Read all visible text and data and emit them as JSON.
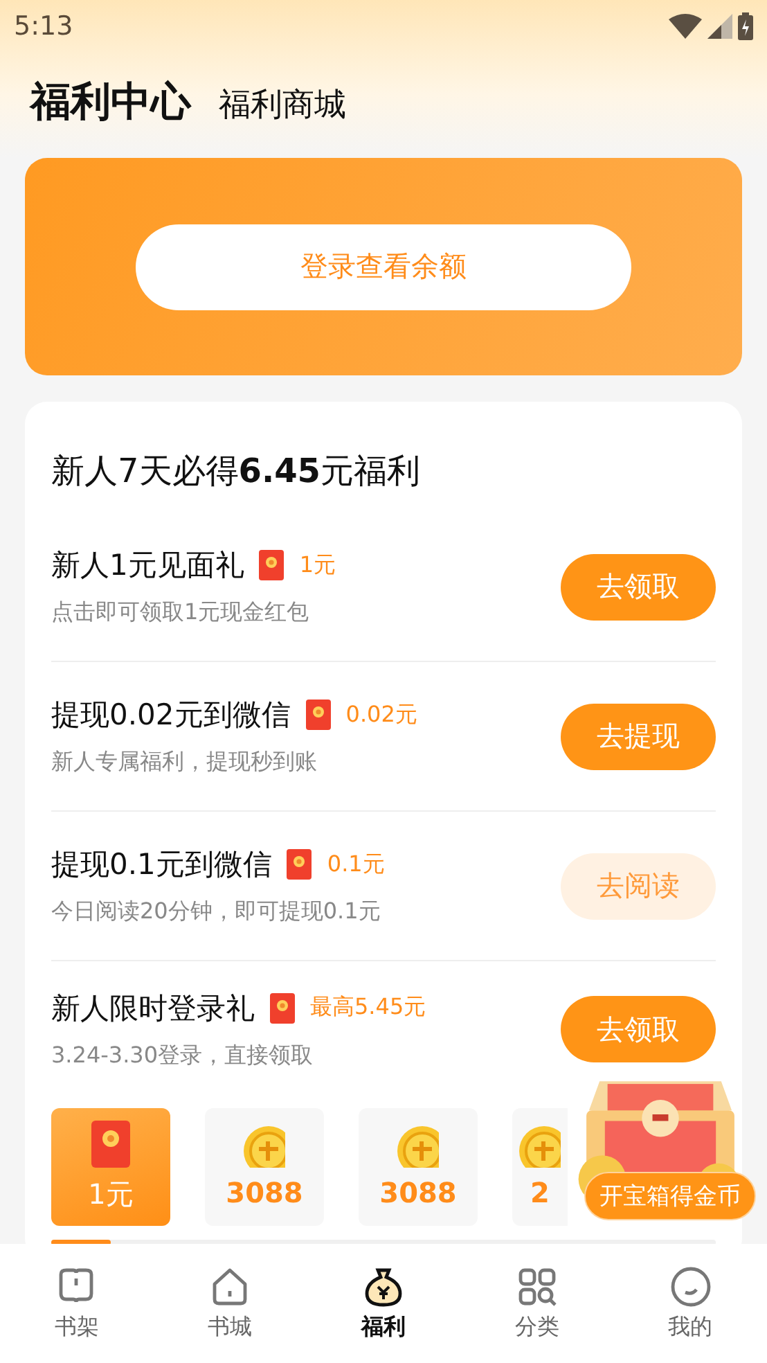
{
  "status_bar": {
    "time": "5:13"
  },
  "header_tabs": [
    {
      "label": "福利中心",
      "selected": true
    },
    {
      "label": "福利商城",
      "selected": false
    }
  ],
  "balance_card": {
    "button": "登录查看余额"
  },
  "newcomer_card": {
    "title": "新人7天必得**6.45**元福利",
    "tasks": [
      {
        "title": "新人1元见面礼",
        "reward": "1元",
        "subtitle": "点击即可领取1元现金红包",
        "button": "去领取",
        "kind": "primary"
      },
      {
        "title": "提现0.02元到微信",
        "reward": "0.02元",
        "subtitle": "新人专属福利，提现秒到账",
        "button": "去提现",
        "kind": "primary"
      },
      {
        "title": "提现0.1元到微信",
        "reward": "0.1元",
        "subtitle": "今日阅读20分钟，即可提现0.1元",
        "button": "去阅读",
        "kind": "soft"
      },
      {
        "title": "新人限时登录礼",
        "reward": "最高5.45元",
        "subtitle": "3.24-3.30登录，直接领取",
        "button": "去领取",
        "kind": "primary"
      }
    ],
    "rewards": [
      {
        "kind": "cash",
        "amount": "1元",
        "selected": true
      },
      {
        "kind": "coin",
        "amount": "3088",
        "selected": false
      },
      {
        "kind": "coin",
        "amount": "3088",
        "selected": false
      },
      {
        "kind": "coin",
        "amount": "2",
        "selected": false
      }
    ],
    "progress": {
      "level": 0.09
    }
  },
  "treasure_badge": "开宝箱得金币",
  "bottom_nav": [
    {
      "label": "书架",
      "selected": false
    },
    {
      "label": "书城",
      "selected": false
    },
    {
      "label": "福利",
      "selected": true
    },
    {
      "label": "分类",
      "selected": false
    },
    {
      "label": "我的",
      "selected": false
    }
  ]
}
